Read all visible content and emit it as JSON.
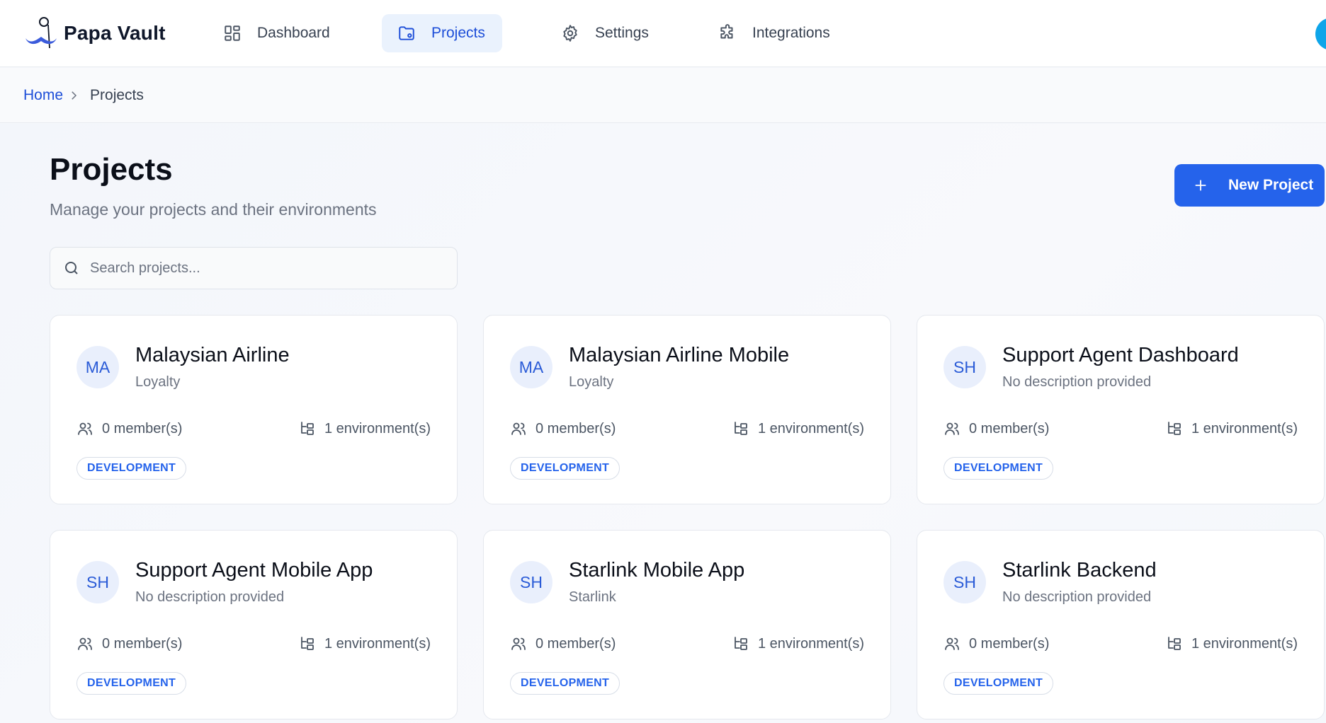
{
  "app": {
    "name": "Papa Vault"
  },
  "nav": {
    "items": [
      {
        "label": "Dashboard",
        "icon": "dashboard-grid-icon",
        "active": false
      },
      {
        "label": "Projects",
        "icon": "folder-icon",
        "active": true
      },
      {
        "label": "Settings",
        "icon": "gear-icon",
        "active": false
      },
      {
        "label": "Integrations",
        "icon": "puzzle-icon",
        "active": false
      }
    ]
  },
  "breadcrumb": {
    "home": "Home",
    "current": "Projects"
  },
  "page": {
    "title": "Projects",
    "subtitle": "Manage your projects and their environments",
    "new_button": "New Project"
  },
  "search": {
    "placeholder": "Search projects...",
    "value": ""
  },
  "projects": [
    {
      "initials": "MA",
      "name": "Malaysian Airline",
      "description": "Loyalty",
      "members": "0 member(s)",
      "environments": "1 environment(s)",
      "tag": "DEVELOPMENT"
    },
    {
      "initials": "MA",
      "name": "Malaysian Airline Mobile",
      "description": "Loyalty",
      "members": "0 member(s)",
      "environments": "1 environment(s)",
      "tag": "DEVELOPMENT"
    },
    {
      "initials": "SH",
      "name": "Support Agent Dashboard",
      "description": "No description provided",
      "members": "0 member(s)",
      "environments": "1 environment(s)",
      "tag": "DEVELOPMENT"
    },
    {
      "initials": "SH",
      "name": "Support Agent Mobile App",
      "description": "No description provided",
      "members": "0 member(s)",
      "environments": "1 environment(s)",
      "tag": "DEVELOPMENT"
    },
    {
      "initials": "SH",
      "name": "Starlink Mobile App",
      "description": "Starlink",
      "members": "0 member(s)",
      "environments": "1 environment(s)",
      "tag": "DEVELOPMENT"
    },
    {
      "initials": "SH",
      "name": "Starlink Backend",
      "description": "No description provided",
      "members": "0 member(s)",
      "environments": "1 environment(s)",
      "tag": "DEVELOPMENT"
    }
  ],
  "colors": {
    "accent": "#2563eb",
    "active_nav_bg": "#eaf2fd",
    "avatar_bg": "#e9effc"
  }
}
